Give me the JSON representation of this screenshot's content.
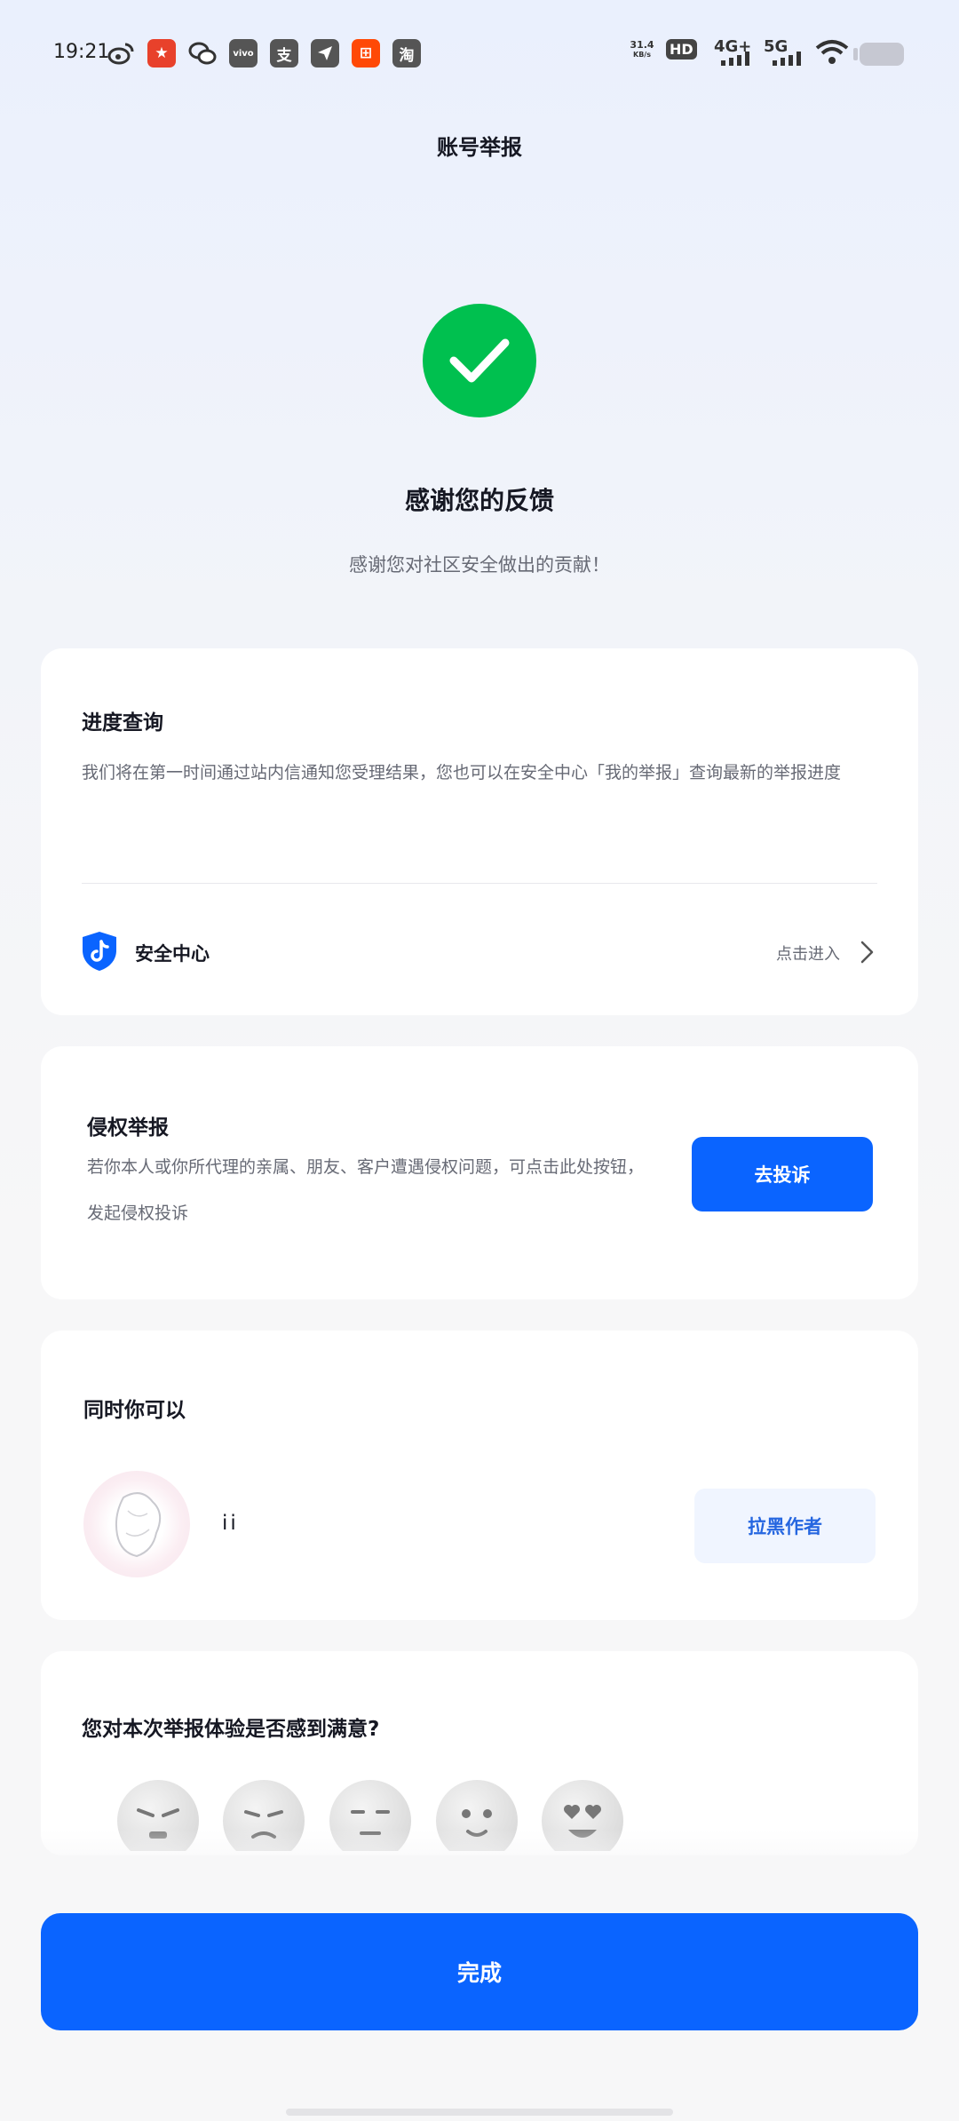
{
  "status_bar": {
    "time": "19:21",
    "icons": [
      "weibo-icon",
      "app-red-icon",
      "wechat-icon",
      "vivo-icon",
      "alipay-icon",
      "send-icon",
      "kuaishou-icon",
      "taobao-icon"
    ],
    "netspeed_value": "31.4",
    "netspeed_unit": "KB/s",
    "hd_label": "HD",
    "network_4g": "4G+",
    "network_5g": "5G"
  },
  "header": {
    "title": "账号举报"
  },
  "result": {
    "title": "感谢您的反馈",
    "subtitle": "感谢您对社区安全做出的贡献！"
  },
  "progress_card": {
    "title": "进度查询",
    "description": "我们将在第一时间通过站内信通知您受理结果，您也可以在安全中心「我的举报」查询最新的举报进度",
    "security_center_label": "安全中心",
    "enter_label": "点击进入"
  },
  "infringement_card": {
    "title": "侵权举报",
    "description": "若你本人或你所代理的亲属、朋友、客户遭遇侵权问题，可点击此处按钮，发起侵权投诉",
    "button_label": "去投诉"
  },
  "also_card": {
    "title": "同时你可以",
    "user_name": "ii",
    "button_label": "拉黑作者"
  },
  "satisfaction": {
    "question": "您对本次举报体验是否感到满意?",
    "faces": [
      "angry-face-icon",
      "frown-face-icon",
      "neutral-face-icon",
      "smile-face-icon",
      "heart-eyes-face-icon"
    ]
  },
  "footer": {
    "done_label": "完成"
  },
  "colors": {
    "primary": "#0a64ff",
    "success": "#00c04f",
    "text": "#161823",
    "secondary_text": "#676a75"
  }
}
